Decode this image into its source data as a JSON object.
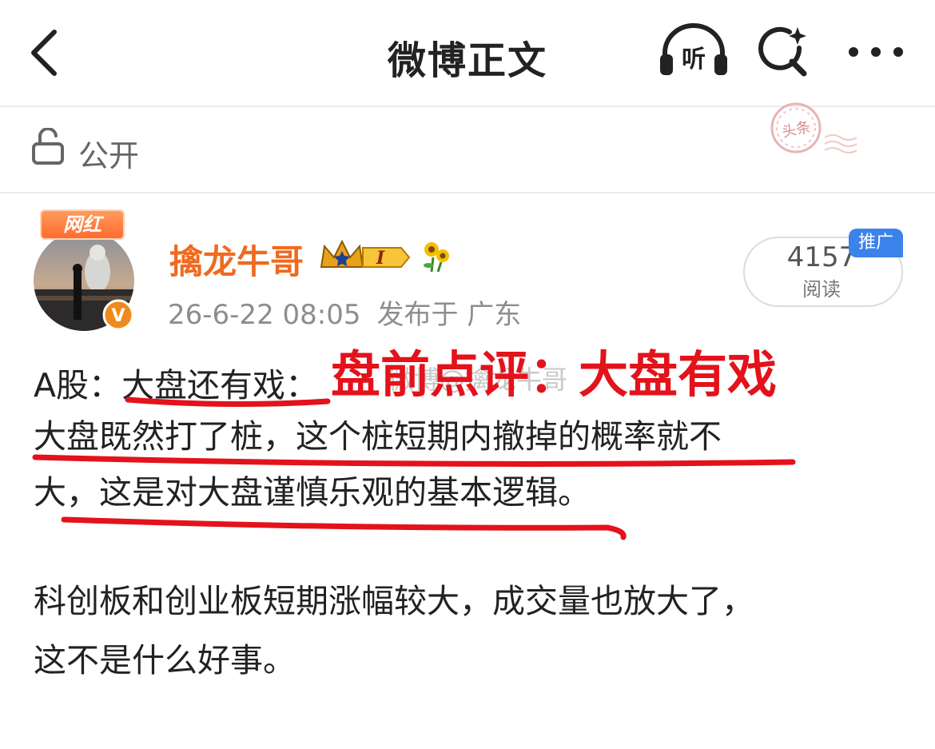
{
  "header": {
    "title": "微博正文",
    "listen_label": "听"
  },
  "visibility": {
    "label": "公开"
  },
  "stamp": {
    "text": "头条"
  },
  "author": {
    "tag": "网红",
    "name": "擒龙牛哥",
    "level": "I",
    "verified_badge": "V"
  },
  "post_meta": {
    "timestamp": "26-6-22 08:05",
    "location": "发布于 广东"
  },
  "read_stats": {
    "count": "4157",
    "label": "阅读",
    "promo_badge": "推广"
  },
  "content": {
    "line1_prefix": "A股：",
    "line1_highlight": "大盘还有戏",
    "line1_suffix": "：",
    "line2": "大盘既然打了桩，这个桩短期内撤掉的概率就不",
    "line3": "大，这是对大盘谨慎乐观的基本逻辑。",
    "line4": "科创板和创业板短期涨幅较大，成交量也放大了，",
    "line5": "这不是什么好事。"
  },
  "overlay": {
    "text": "盘前点评：大盘有戏",
    "color": "#e3121b"
  },
  "watermark": {
    "text": "微博@擒龙牛哥"
  },
  "colors": {
    "author_name": "#f06a1e",
    "promo_badge": "#3b82ea",
    "meta_text": "#8d8d8d",
    "annotation": "#e3121b"
  },
  "icons": [
    "back-icon",
    "listen-icon",
    "ai-search-icon",
    "more-icon",
    "lock-icon",
    "crown-icon",
    "sunflower-icon",
    "verified-badge-icon"
  ]
}
